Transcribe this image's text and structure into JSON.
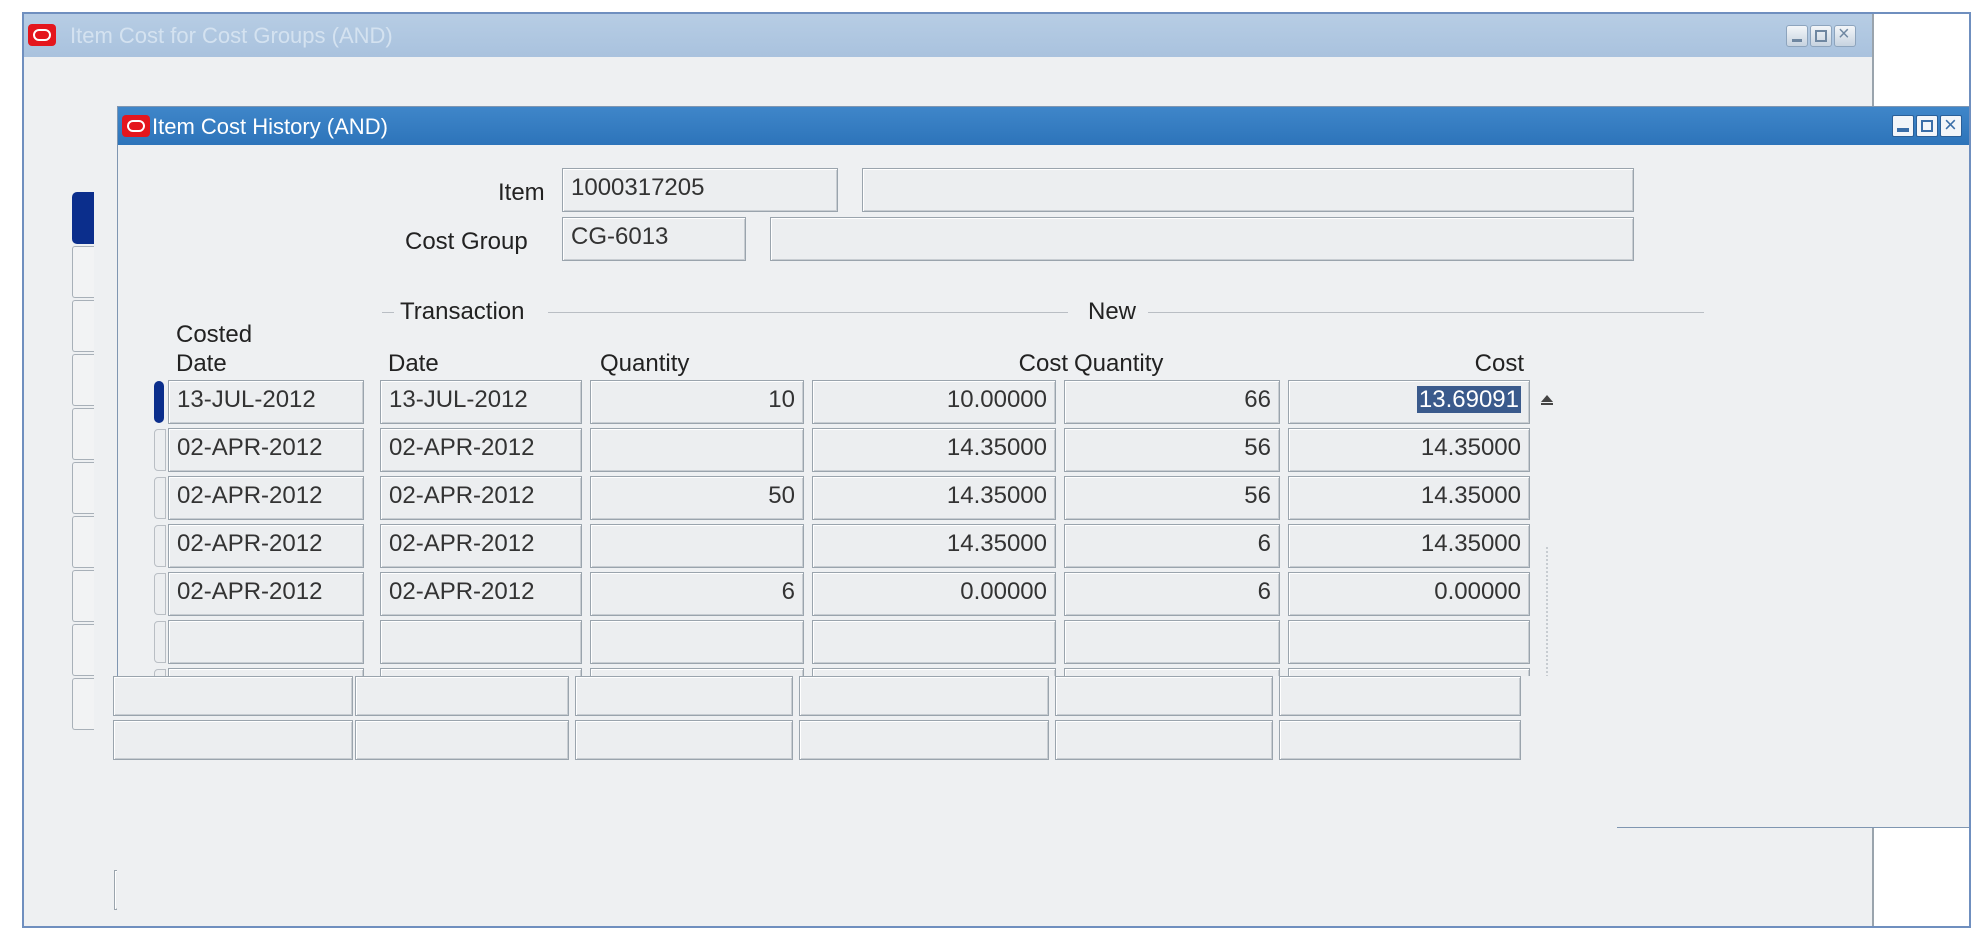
{
  "back_window": {
    "title": "Item Cost for Cost Groups (AND)"
  },
  "front_window": {
    "title": "Item Cost History (AND)"
  },
  "header": {
    "item_label": "Item",
    "item_value": "1000317205",
    "item_desc": "",
    "cost_group_label": "Cost Group",
    "cost_group_value": "CG-6013",
    "cost_group_desc": ""
  },
  "table": {
    "groups": {
      "transaction": "Transaction",
      "new": "New"
    },
    "costed_top": "Costed",
    "columns": [
      "Date",
      "Date",
      "Quantity",
      "Cost",
      "Quantity",
      "Cost"
    ],
    "rows": [
      {
        "costed_date": "13-JUL-2012",
        "txn_date": "13-JUL-2012",
        "txn_qty": "10",
        "txn_cost": "10.00000",
        "new_qty": "66",
        "new_cost": "13.69091"
      },
      {
        "costed_date": "02-APR-2012",
        "txn_date": "02-APR-2012",
        "txn_qty": "",
        "txn_cost": "14.35000",
        "new_qty": "56",
        "new_cost": "14.35000"
      },
      {
        "costed_date": "02-APR-2012",
        "txn_date": "02-APR-2012",
        "txn_qty": "50",
        "txn_cost": "14.35000",
        "new_qty": "56",
        "new_cost": "14.35000"
      },
      {
        "costed_date": "02-APR-2012",
        "txn_date": "02-APR-2012",
        "txn_qty": "",
        "txn_cost": "14.35000",
        "new_qty": "6",
        "new_cost": "14.35000"
      },
      {
        "costed_date": "02-APR-2012",
        "txn_date": "02-APR-2012",
        "txn_qty": "6",
        "txn_cost": "0.00000",
        "new_qty": "6",
        "new_cost": "0.00000"
      },
      {
        "costed_date": "",
        "txn_date": "",
        "txn_qty": "",
        "txn_cost": "",
        "new_qty": "",
        "new_cost": ""
      },
      {
        "costed_date": "",
        "txn_date": "",
        "txn_qty": "",
        "txn_cost": "",
        "new_qty": "",
        "new_cost": ""
      }
    ]
  },
  "colors": {
    "title_active": "#2d74ba",
    "title_inactive": "#a9c2de",
    "selection": "#3a5a8c",
    "row_marker": "#0b2e8c"
  },
  "icons": [
    "oracle-logo-icon",
    "minimize-icon",
    "maximize-icon",
    "close-icon",
    "scroll-up-arrow-icon"
  ]
}
